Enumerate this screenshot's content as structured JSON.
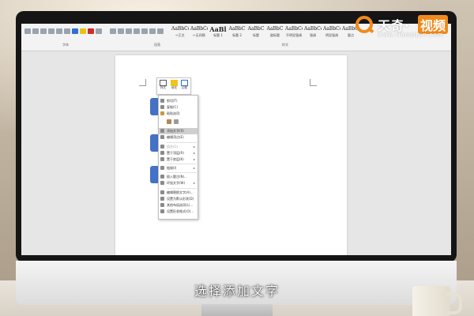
{
  "ribbon": {
    "groups": [
      "字体",
      "段落",
      "样式"
    ],
    "styles": [
      {
        "sample": "AaBbCcDd",
        "name": "↵正文"
      },
      {
        "sample": "AaBbCcDd",
        "name": "↵无间隔"
      },
      {
        "sample": "AaBl",
        "name": "标题 1",
        "big": true
      },
      {
        "sample": "AaBbC",
        "name": "标题 2"
      },
      {
        "sample": "AaBbC",
        "name": "标题"
      },
      {
        "sample": "AaBbC",
        "name": "副标题"
      },
      {
        "sample": "AaBbCcDd",
        "name": "不明显强调"
      },
      {
        "sample": "AaBbCcDd",
        "name": "强调"
      },
      {
        "sample": "AaBbCcDd",
        "name": "明显强调"
      },
      {
        "sample": "AaBbCcDd",
        "name": "要点"
      }
    ]
  },
  "mini_toolbar": {
    "buttons": [
      {
        "label": "样式",
        "icon": "style-icon"
      },
      {
        "label": "填充",
        "icon": "fill-icon"
      },
      {
        "label": "边框",
        "icon": "outline-icon"
      }
    ]
  },
  "context_menu": {
    "items": [
      {
        "label": "剪切(T)",
        "icon": "scissors-icon"
      },
      {
        "label": "复制(C)",
        "icon": "copy-icon"
      },
      {
        "label": "粘贴选项:",
        "icon": "clipboard-icon"
      },
      {
        "label": "",
        "icon": "paste-option-icon"
      },
      {
        "label": "添加文字(X)",
        "icon": "text-icon",
        "highlighted": true
      },
      {
        "label": "编辑顶点(E)",
        "icon": "edit-points-icon"
      },
      {
        "label": "组合(G)",
        "icon": "group-icon",
        "arrow": true,
        "disabled": true
      },
      {
        "label": "置于顶层(R)",
        "icon": "bring-front-icon",
        "arrow": true
      },
      {
        "label": "置于底层(K)",
        "icon": "send-back-icon",
        "arrow": true
      },
      {
        "label": "链接(I)",
        "icon": "link-icon",
        "arrow": true
      },
      {
        "label": "插入题注(N)...",
        "icon": "caption-icon"
      },
      {
        "label": "环绕文字(W)",
        "icon": "wrap-icon",
        "arrow": true
      },
      {
        "label": "编辑替换文字(A)...",
        "icon": "alt-text-icon"
      },
      {
        "label": "设置为默认形状(D)",
        "icon": "default-shape-icon"
      },
      {
        "label": "其他布局选项(L)...",
        "icon": "layout-icon"
      },
      {
        "label": "设置形状格式(O)...",
        "icon": "format-shape-icon"
      }
    ]
  },
  "logo": {
    "brand": "天奇·",
    "brand_highlight": "视频",
    "url": "www.tianqijun.com",
    "color": "#f08a1c"
  },
  "caption": "选择添加文字",
  "colors": {
    "shape": "#4472c4",
    "menu_highlight": "#cfcfcf"
  }
}
